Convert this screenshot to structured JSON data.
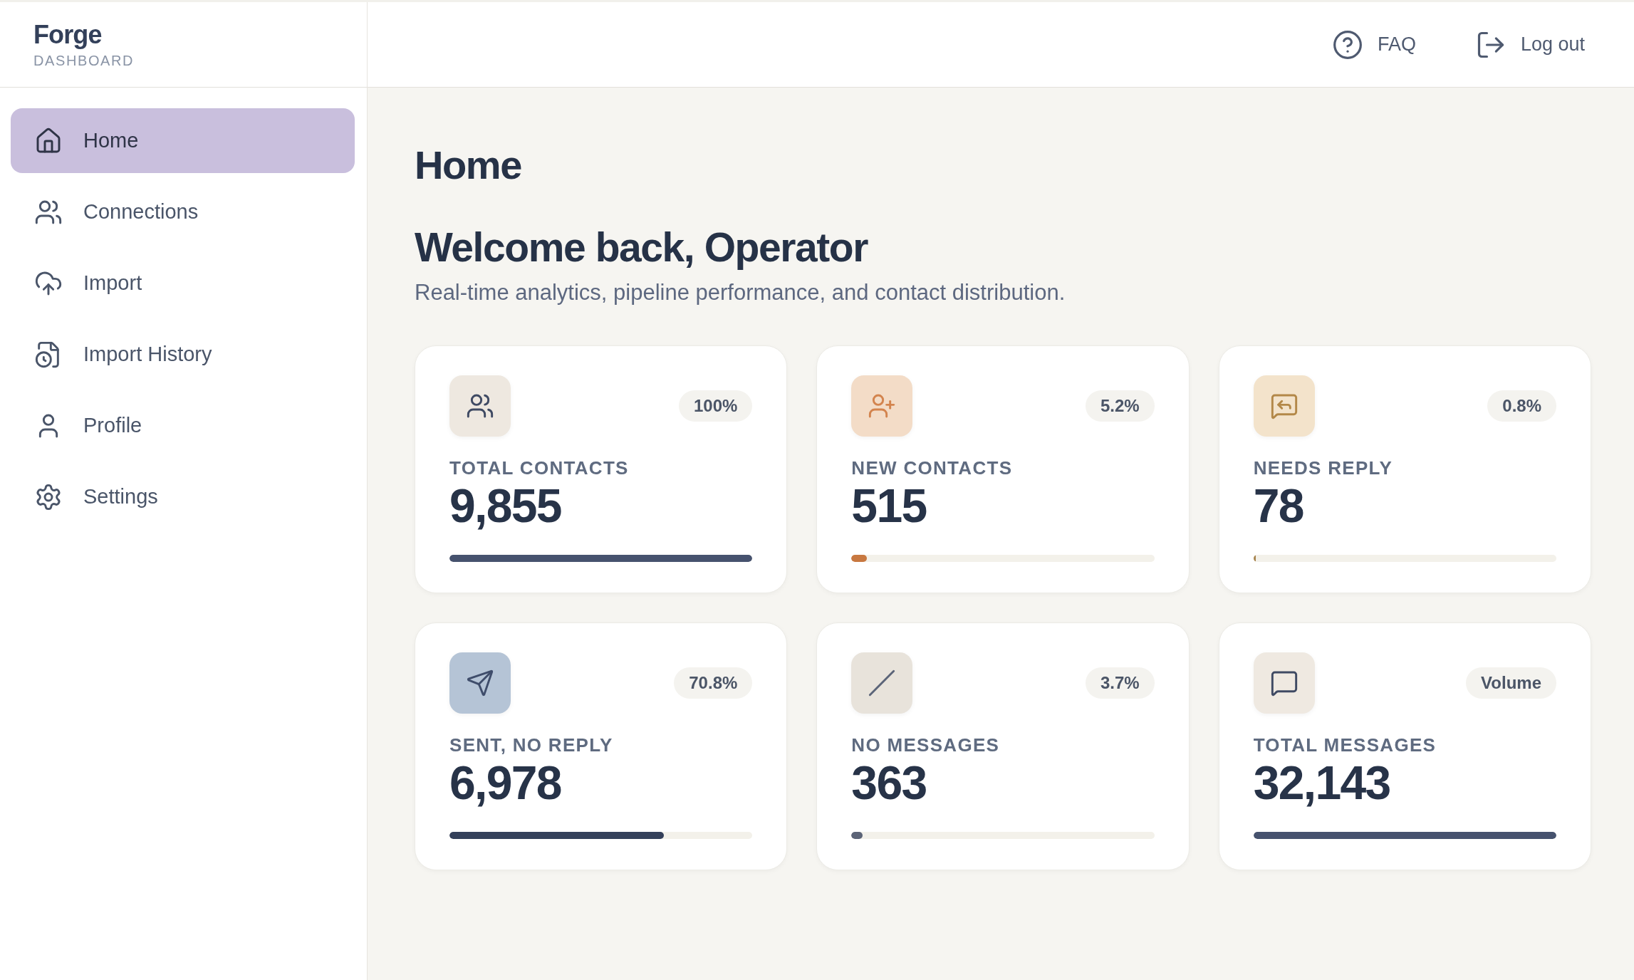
{
  "sidebar": {
    "brand": {
      "title": "Forge",
      "subtitle": "DASHBOARD"
    },
    "items": [
      {
        "label": "Home",
        "selected": true
      },
      {
        "label": "Connections",
        "selected": false
      },
      {
        "label": "Import",
        "selected": false
      },
      {
        "label": "Import History",
        "selected": false
      },
      {
        "label": "Profile",
        "selected": false
      },
      {
        "label": "Settings",
        "selected": false
      }
    ]
  },
  "top_bar": {
    "links": [
      {
        "label": "FAQ"
      },
      {
        "label": "Log out"
      }
    ]
  },
  "page": {
    "title": "Home",
    "heading": "Welcome back, Operator",
    "description": "Real-time analytics, pipeline performance, and contact distribution."
  },
  "cards": [
    {
      "label": "TOTAL CONTACTS",
      "value": "9,855",
      "badge": "100%",
      "level": 1,
      "color": "#46526e"
    },
    {
      "label": "NEW CONTACTS",
      "value": "515",
      "badge": "5.2%",
      "level": 0.052,
      "color": "#c87840"
    },
    {
      "label": "NEEDS REPLY",
      "value": "78",
      "badge": "0.8%",
      "level": 0.008,
      "color": "#a88550"
    },
    {
      "label": "SENT, NO REPLY",
      "value": "6,978",
      "badge": "70.8%",
      "level": 0.708,
      "color": "#34405a"
    },
    {
      "label": "NO MESSAGES",
      "value": "363",
      "badge": "3.7%",
      "level": 0.037,
      "color": "#5c6477"
    },
    {
      "label": "TOTAL MESSAGES",
      "value": "32,143",
      "badge": "Volume",
      "level": 1,
      "color": "#46526e"
    }
  ]
}
